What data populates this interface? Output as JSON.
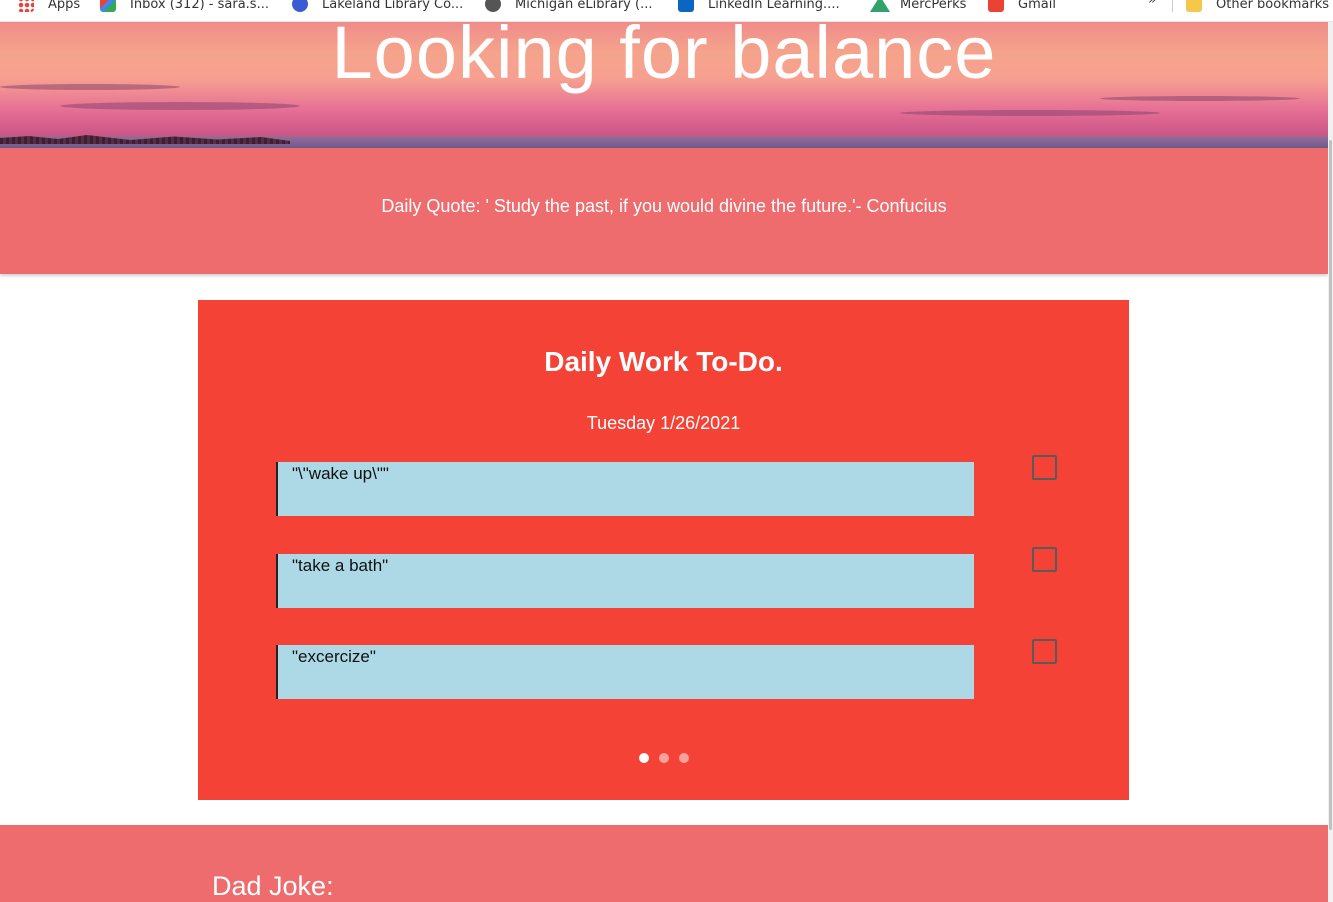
{
  "bookmarks": {
    "items": [
      {
        "label": "Apps",
        "icon": "apps-grid-icon"
      },
      {
        "label": "Inbox (312) - sara.s...",
        "icon": "gmail-icon"
      },
      {
        "label": "Lakeland Library Co...",
        "icon": "library-icon"
      },
      {
        "label": "Michigan eLibrary (...",
        "icon": "globe-icon"
      },
      {
        "label": "LinkedIn Learning....",
        "icon": "linkedin-icon"
      },
      {
        "label": "MercPerks",
        "icon": "mercperks-icon"
      },
      {
        "label": "Gmail",
        "icon": "gmail-icon"
      }
    ],
    "more": "»",
    "other": "Other bookmarks"
  },
  "hero": {
    "title": "Looking for balance"
  },
  "quote": {
    "text": "Daily Quote: ' Study the past, if you would divine the future.'- Confucius"
  },
  "todo": {
    "title": "Daily Work To-Do.",
    "date": "Tuesday 1/26/2021",
    "tasks": [
      {
        "text": "\"\\\"wake up\\\"\"",
        "checked": false
      },
      {
        "text": "\"take a bath\"",
        "checked": false
      },
      {
        "text": "\"excercize\"",
        "checked": false
      }
    ],
    "pagination": {
      "count": 3,
      "active": 1
    }
  },
  "joke": {
    "title": "Dad Joke:"
  },
  "colors": {
    "hero_band": "#ee6c6e",
    "card": "#f44336",
    "task_bg": "#add8e6"
  }
}
